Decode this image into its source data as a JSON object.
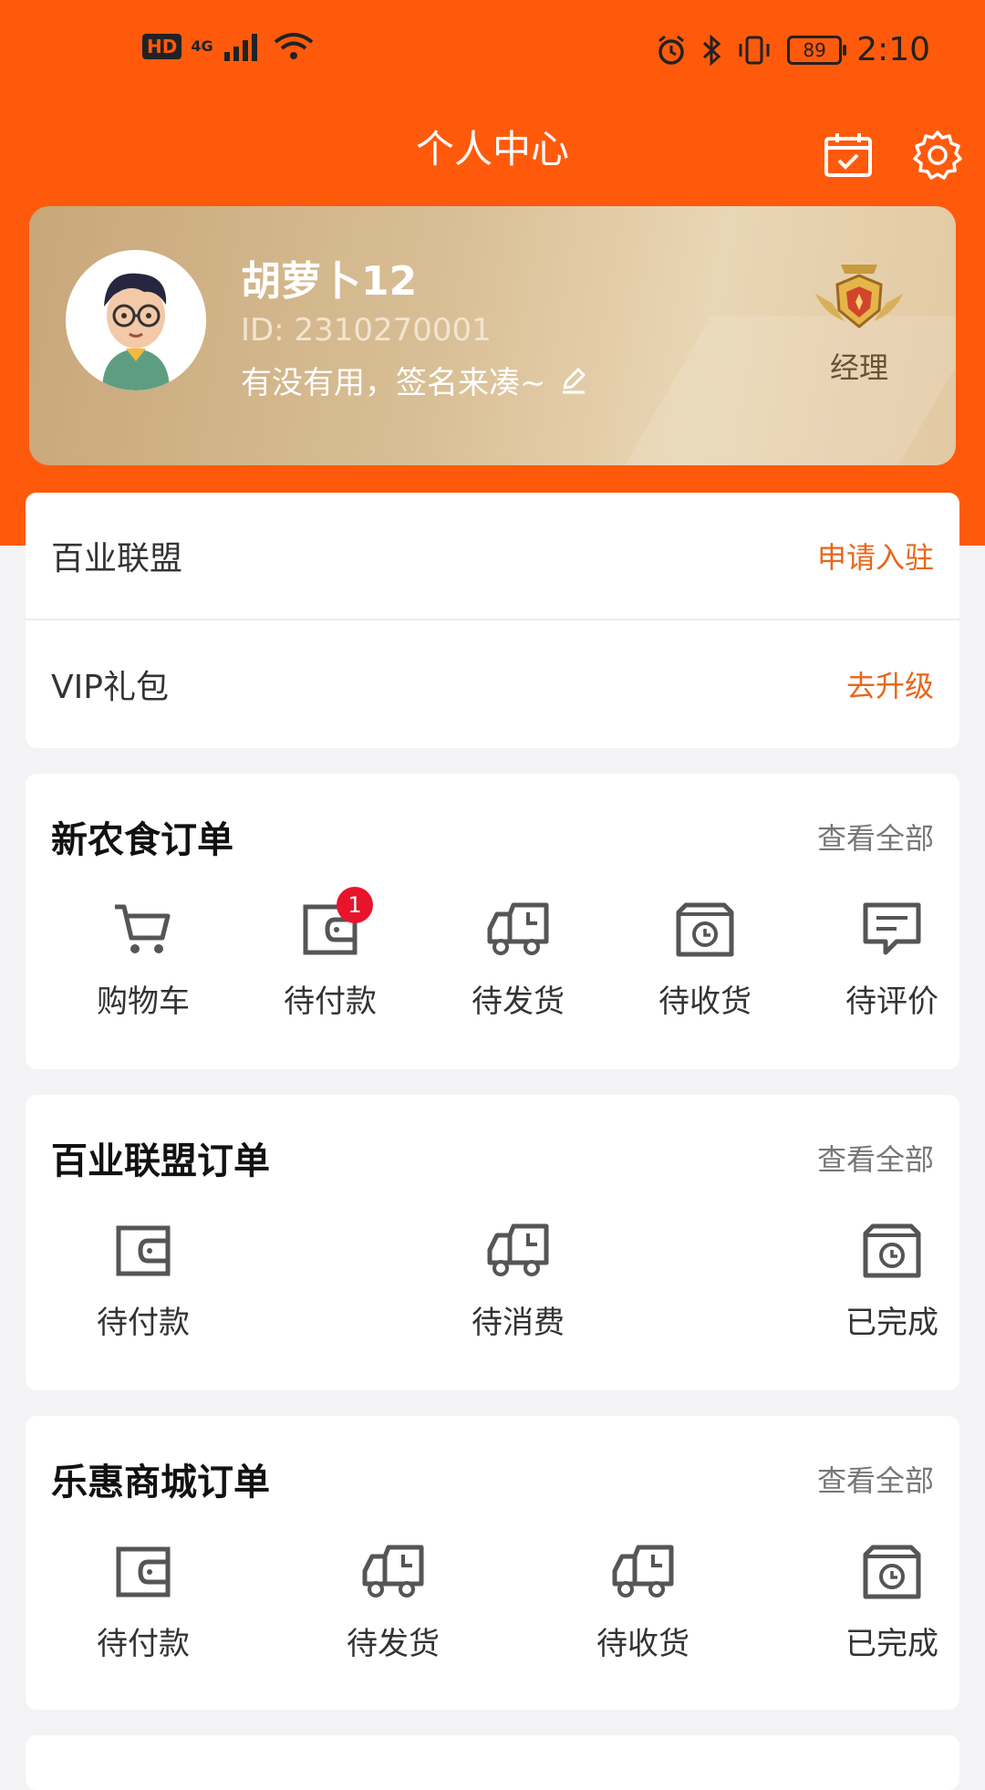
{
  "status_bar": {
    "hd": "HD",
    "network": "4G",
    "battery": "89",
    "time": "2:10"
  },
  "header": {
    "title": "个人中心",
    "icons": [
      "calendar-check-icon",
      "gear-icon"
    ]
  },
  "profile": {
    "name": "胡萝卜12",
    "id": "ID: 2310270001",
    "signature": "有没有用，签名来凑~",
    "level": "经理"
  },
  "rows": [
    {
      "label": "百业联盟",
      "action": "申请入驻"
    },
    {
      "label": "VIP礼包",
      "action": "去升级"
    }
  ],
  "orders": [
    {
      "title": "新农食订单",
      "more": "查看全部",
      "items": [
        {
          "label": "购物车",
          "icon": "cart-icon"
        },
        {
          "label": "待付款",
          "icon": "wallet-icon",
          "badge": "1"
        },
        {
          "label": "待发货",
          "icon": "truck-icon"
        },
        {
          "label": "待收货",
          "icon": "box-clock-icon"
        },
        {
          "label": "待评价",
          "icon": "comment-icon"
        }
      ]
    },
    {
      "title": "百业联盟订单",
      "more": "查看全部",
      "items": [
        {
          "label": "待付款",
          "icon": "wallet-icon"
        },
        {
          "label": "待消费",
          "icon": "truck-icon"
        },
        {
          "label": "已完成",
          "icon": "box-clock-icon"
        }
      ]
    },
    {
      "title": "乐惠商城订单",
      "more": "查看全部",
      "items": [
        {
          "label": "待付款",
          "icon": "wallet-icon"
        },
        {
          "label": "待发货",
          "icon": "truck-icon"
        },
        {
          "label": "待收货",
          "icon": "truck-icon"
        },
        {
          "label": "已完成",
          "icon": "box-clock-icon"
        }
      ]
    }
  ],
  "colors": {
    "accent": "#ff5a0c",
    "action_text": "#e8661a",
    "badge": "#e8142c"
  }
}
